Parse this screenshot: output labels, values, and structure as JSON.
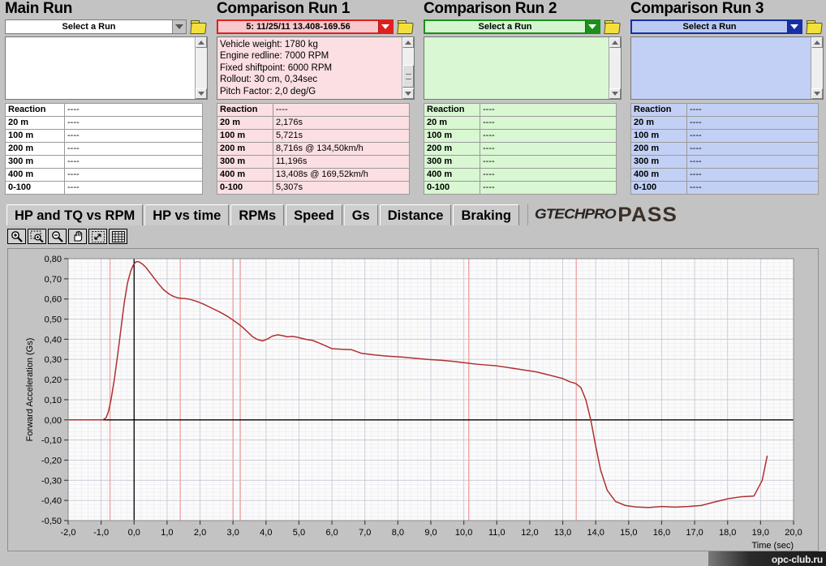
{
  "panels": [
    {
      "id": "main-run",
      "title": "Main Run",
      "combo_value": "Select a Run",
      "info_text": "",
      "rows": [
        {
          "label": "Reaction",
          "value": "----"
        },
        {
          "label": "20 m",
          "value": "----"
        },
        {
          "label": "100 m",
          "value": "----"
        },
        {
          "label": "200 m",
          "value": "----"
        },
        {
          "label": "300 m",
          "value": "----"
        },
        {
          "label": "400 m",
          "value": "----"
        },
        {
          "label": "0-100",
          "value": "----"
        }
      ]
    },
    {
      "id": "comparison-run-1",
      "title": "Comparison Run 1",
      "combo_value": "5:   11/25/11 13.408-169.56",
      "info_text": "Vehicle weight: 1780 kg\nEngine redline: 7000 RPM\nFixed shiftpoint: 6000 RPM\nRollout: 30 cm, 0,34sec\nPitch Factor: 2,0 deg/G",
      "rows": [
        {
          "label": "Reaction",
          "value": "----"
        },
        {
          "label": "20 m",
          "value": "2,176s"
        },
        {
          "label": "100 m",
          "value": "5,721s"
        },
        {
          "label": "200 m",
          "value": "8,716s @ 134,50km/h"
        },
        {
          "label": "300 m",
          "value": "11,196s"
        },
        {
          "label": "400 m",
          "value": "13,408s @ 169,52km/h"
        },
        {
          "label": "0-100",
          "value": "5,307s"
        }
      ]
    },
    {
      "id": "comparison-run-2",
      "title": "Comparison Run 2",
      "combo_value": "Select a Run",
      "info_text": "",
      "rows": [
        {
          "label": "Reaction",
          "value": "----"
        },
        {
          "label": "20 m",
          "value": "----"
        },
        {
          "label": "100 m",
          "value": "----"
        },
        {
          "label": "200 m",
          "value": "----"
        },
        {
          "label": "300 m",
          "value": "----"
        },
        {
          "label": "400 m",
          "value": "----"
        },
        {
          "label": "0-100",
          "value": "----"
        }
      ]
    },
    {
      "id": "comparison-run-3",
      "title": "Comparison Run 3",
      "combo_value": "Select a Run",
      "info_text": "",
      "rows": [
        {
          "label": "Reaction",
          "value": "----"
        },
        {
          "label": "20 m",
          "value": "----"
        },
        {
          "label": "100 m",
          "value": "----"
        },
        {
          "label": "200 m",
          "value": "----"
        },
        {
          "label": "300 m",
          "value": "----"
        },
        {
          "label": "400 m",
          "value": "----"
        },
        {
          "label": "0-100",
          "value": "----"
        }
      ]
    }
  ],
  "tabs": [
    {
      "label": "HP and TQ vs RPM",
      "active": false
    },
    {
      "label": "HP vs time",
      "active": false
    },
    {
      "label": "RPMs",
      "active": false
    },
    {
      "label": "Speed",
      "active": false
    },
    {
      "label": "Gs",
      "active": true
    },
    {
      "label": "Distance",
      "active": false
    },
    {
      "label": "Braking",
      "active": false
    }
  ],
  "logo": {
    "brand": "GTECHPRO",
    "product": "PASS"
  },
  "chart_toolbar": [
    {
      "name": "zoom-in-icon",
      "title": "Zoom In"
    },
    {
      "name": "zoom-box-icon",
      "title": "Zoom Box"
    },
    {
      "name": "zoom-out-icon",
      "title": "Zoom Out"
    },
    {
      "name": "pan-hand-icon",
      "title": "Pan"
    },
    {
      "name": "fit-to-window-icon",
      "title": "Fit"
    },
    {
      "name": "grid-icon",
      "title": "Grid"
    }
  ],
  "watermark": "opc-club.ru",
  "colors": {
    "run1": "#b03030",
    "run2": "#1a8f1a",
    "run3": "#1630a8",
    "marker": "#f0a0a0",
    "desktop": "#c3c3c3"
  },
  "chart_data": {
    "type": "line",
    "title": "",
    "xlabel": "Time (sec)",
    "ylabel": "Forward Acceleration (Gs)",
    "xlim": [
      -2.0,
      20.0
    ],
    "ylim": [
      -0.5,
      0.8
    ],
    "xticks": [
      "-2,0",
      "-1,0",
      "0,0",
      "1,0",
      "2,0",
      "3,0",
      "4,0",
      "5,0",
      "6,0",
      "7,0",
      "8,0",
      "9,0",
      "10,0",
      "11,0",
      "12,0",
      "13,0",
      "14,0",
      "15,0",
      "16,0",
      "17,0",
      "18,0",
      "19,0",
      "20,0"
    ],
    "yticks": [
      "0,80",
      "0,70",
      "0,60",
      "0,50",
      "0,40",
      "0,30",
      "0,20",
      "0,10",
      "0,00",
      "-0,10",
      "-0,20",
      "-0,30",
      "-0,40",
      "-0,50"
    ],
    "grid": true,
    "legend": "none",
    "zero_line_y": 0.0,
    "cursor_line_x": 0.0,
    "markers_x": [
      -0.73,
      1.4,
      3.0,
      3.22,
      10.15,
      13.41
    ],
    "series": [
      {
        "name": "Comparison Run 1 - Forward Acceleration",
        "color": "#b03030",
        "x": [
          -2.0,
          -1.6,
          -1.3,
          -1.1,
          -0.95,
          -0.85,
          -0.78,
          -0.7,
          -0.6,
          -0.5,
          -0.4,
          -0.3,
          -0.2,
          -0.1,
          -0.02,
          0.06,
          0.14,
          0.24,
          0.34,
          0.46,
          0.6,
          0.74,
          0.9,
          1.06,
          1.2,
          1.34,
          1.46,
          1.56,
          1.7,
          1.9,
          2.1,
          2.35,
          2.6,
          2.85,
          3.0,
          3.15,
          3.3,
          3.45,
          3.6,
          3.75,
          3.9,
          4.05,
          4.2,
          4.35,
          4.5,
          4.65,
          4.8,
          4.95,
          5.1,
          5.25,
          5.4,
          5.6,
          5.8,
          6.0,
          6.3,
          6.6,
          6.9,
          7.3,
          7.7,
          8.1,
          8.5,
          8.9,
          9.3,
          9.7,
          10.1,
          10.4,
          10.7,
          11.0,
          11.4,
          11.8,
          12.2,
          12.6,
          13.0,
          13.2,
          13.4,
          13.55,
          13.7,
          13.85,
          14.0,
          14.15,
          14.35,
          14.6,
          14.9,
          15.2,
          15.6,
          16.0,
          16.4,
          16.8,
          17.2,
          17.6,
          18.0,
          18.4,
          18.8,
          19.05,
          19.2
        ],
        "y": [
          0.0,
          0.0,
          0.0,
          0.0,
          0.0,
          0.01,
          0.04,
          0.1,
          0.2,
          0.32,
          0.45,
          0.58,
          0.68,
          0.74,
          0.77,
          0.785,
          0.785,
          0.775,
          0.76,
          0.735,
          0.705,
          0.675,
          0.645,
          0.625,
          0.612,
          0.605,
          0.603,
          0.602,
          0.598,
          0.588,
          0.575,
          0.555,
          0.535,
          0.512,
          0.495,
          0.478,
          0.458,
          0.435,
          0.412,
          0.398,
          0.392,
          0.402,
          0.416,
          0.422,
          0.418,
          0.412,
          0.414,
          0.41,
          0.404,
          0.398,
          0.395,
          0.382,
          0.368,
          0.353,
          0.35,
          0.348,
          0.33,
          0.322,
          0.316,
          0.312,
          0.306,
          0.3,
          0.296,
          0.29,
          0.282,
          0.276,
          0.272,
          0.268,
          0.258,
          0.248,
          0.238,
          0.222,
          0.205,
          0.19,
          0.18,
          0.16,
          0.1,
          0.0,
          -0.13,
          -0.25,
          -0.35,
          -0.405,
          -0.425,
          -0.432,
          -0.435,
          -0.43,
          -0.433,
          -0.43,
          -0.425,
          -0.408,
          -0.392,
          -0.382,
          -0.378,
          -0.3,
          -0.18
        ]
      }
    ]
  }
}
